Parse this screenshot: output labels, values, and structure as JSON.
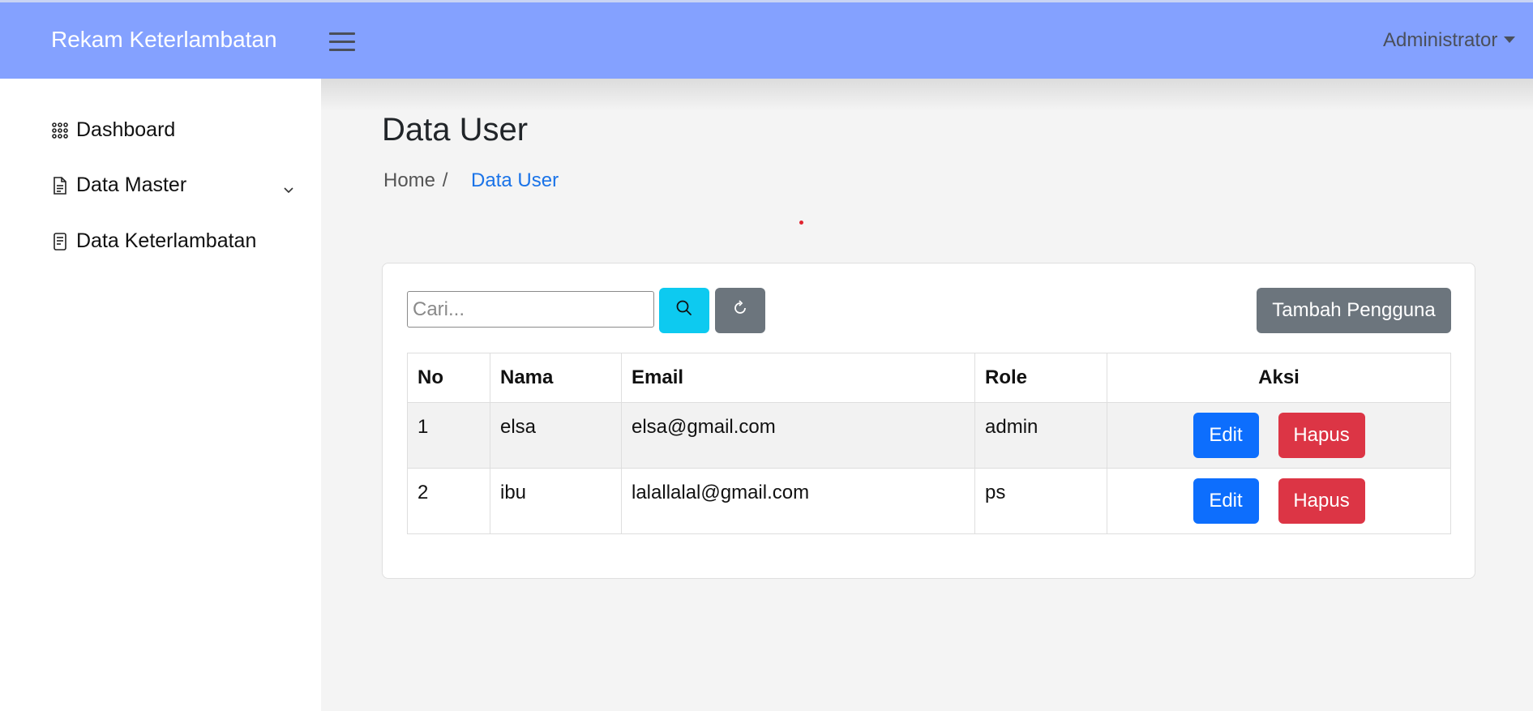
{
  "navbar": {
    "brand": "Rekam Keterlambatan",
    "user": "Administrator",
    "bg_color": "#84a1ff"
  },
  "sidebar": {
    "items": [
      {
        "label": "Dashboard",
        "icon": "grid-dots-icon"
      },
      {
        "label": "Data Master",
        "icon": "file-text-icon",
        "has_submenu": true
      },
      {
        "label": "Data Keterlambatan",
        "icon": "document-icon"
      }
    ]
  },
  "page": {
    "title": "Data User",
    "breadcrumb": {
      "home": "Home",
      "separator": "/",
      "current": "Data User"
    }
  },
  "toolbar": {
    "search_placeholder": "Cari...",
    "search_value": "",
    "add_label": "Tambah Pengguna"
  },
  "table": {
    "headers": {
      "no": "No",
      "nama": "Nama",
      "email": "Email",
      "role": "Role",
      "aksi": "Aksi"
    },
    "rows": [
      {
        "no": "1",
        "nama": "elsa",
        "email": "elsa@gmail.com",
        "role": "admin",
        "edit": "Edit",
        "delete": "Hapus"
      },
      {
        "no": "2",
        "nama": "ibu",
        "email": "lalallalal@gmail.com",
        "role": "ps",
        "edit": "Edit",
        "delete": "Hapus"
      }
    ]
  },
  "colors": {
    "search_button": "#0dcaf0",
    "secondary_button": "#6c757d",
    "edit_button": "#0d6efd",
    "delete_button": "#dc3545",
    "breadcrumb_active": "#1a73e8"
  }
}
